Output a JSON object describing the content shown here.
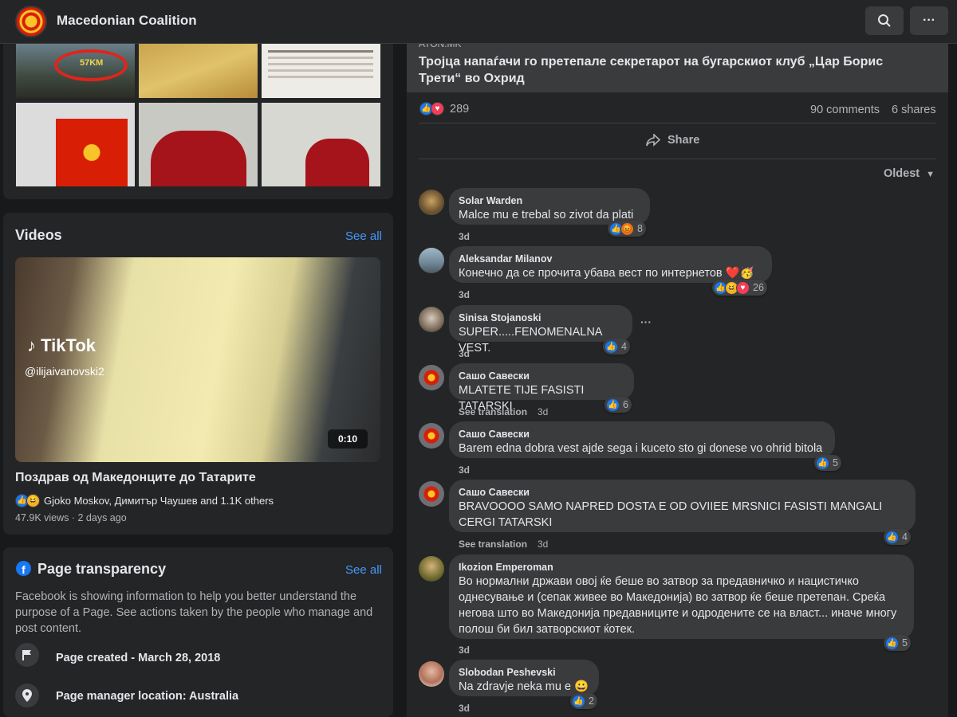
{
  "page": {
    "name": "Macedonian Coalition"
  },
  "videos": {
    "title": "Videos",
    "see_all": "See all",
    "tiktok_brand": "TikTok",
    "tiktok_handle": "@ilijaivanovski2",
    "duration": "0:10",
    "video_title": "Поздрав од Македонците до Татарите",
    "reactors": "Gjoko Moskov, Димитър Чаушев and 1.1K others",
    "stats": "47.9K views · 2 days ago"
  },
  "photo_thumb_text": {
    "sign": "57KM"
  },
  "transparency": {
    "title": "Page transparency",
    "see_all": "See all",
    "description": "Facebook is showing information to help you better understand the purpose of a Page. See actions taken by the people who manage and post content.",
    "created": "Page created - March 28, 2018",
    "manager_location": "Page manager location: Australia"
  },
  "post": {
    "source": "ATON.MK",
    "headline": "Тројца напаѓачи го претепале секретарот на бугарскиот клуб „Цар Борис Трети“ во Охрид",
    "reaction_count": "289",
    "comments_count": "90 comments",
    "shares_count": "6 shares",
    "share_label": "Share",
    "sort_label": "Oldest"
  },
  "comments": [
    {
      "name": "Solar Warden",
      "text": "Malce mu e trebal so zivot da plati",
      "time": "3d",
      "reactions": "8"
    },
    {
      "name": "Aleksandar Milanov",
      "text": "Конечно да се прочита убава вест по интернетов ❤️🥳",
      "time": "3d",
      "reactions": "26"
    },
    {
      "name": "Sinisa Stojanoski",
      "text": "SUPER.....FENOMENALNA VEST.",
      "time": "3d",
      "reactions": "4"
    },
    {
      "name": "Сашо Савески",
      "text": "MLATETE TIJE FASISTI TATARSKI",
      "time": "3d",
      "translate": "See translation",
      "reactions": "6"
    },
    {
      "name": "Сашо Савески",
      "text": "Barem edna dobra vest ajde sega i kuceto sto gi donese vo ohrid bitola",
      "time": "3d",
      "reactions": "5"
    },
    {
      "name": "Сашо Савески",
      "text": "BRAVOOOO SAMO NAPRED DOSTA E OD OVIIEE MRSNICI FASISTI MANGALI CERGI TATARSKI",
      "time": "3d",
      "translate": "See translation",
      "reactions": "4"
    },
    {
      "name": "Ikozion Emperoman",
      "text": "Во нормални држави овој ќе беше во затвор за предавничко и нацистичко однесување и (сепак живее во Македонија) во затвор ќе беше претепан. Среќа негова што во Македонија предавниците и одродените се на власт... иначе многу полош би бил затворскиот ќотек.",
      "time": "3d",
      "reactions": "5"
    },
    {
      "name": "Slobodan Peshevski",
      "text": "Na zdravje neka mu e 😀",
      "time": "3d",
      "reactions": "2"
    }
  ],
  "colors": {
    "accent": "#4599ff",
    "like": "#1877f2",
    "love": "#f33e58",
    "bg": "#18191a",
    "card": "#242526"
  }
}
